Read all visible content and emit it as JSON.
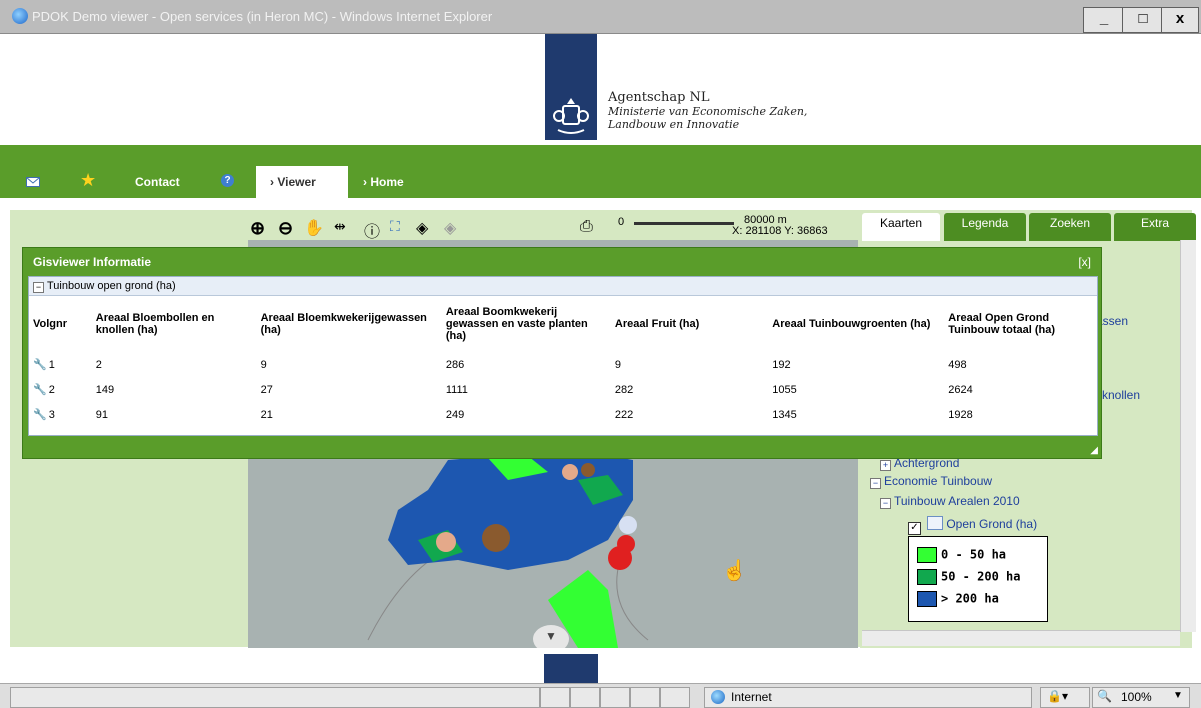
{
  "window": {
    "title": "PDOK Demo viewer - Open services (in Heron MC) - Windows Internet Explorer",
    "min": "_",
    "max": "□",
    "close": "x"
  },
  "header": {
    "agency_name": "Agentschap NL",
    "ministry_line1": "Ministerie van Economische Zaken,",
    "ministry_line2": "Landbouw en Innovatie"
  },
  "nav": {
    "contact": "Contact",
    "viewer": "› Viewer",
    "home": "› Home"
  },
  "toolbar": {
    "scale_start": "0",
    "scale_end": "80000 m",
    "coords": "X: 281108   Y: 36863"
  },
  "tabs": [
    "Kaarten",
    "Legenda",
    "Zoeken",
    "Extra"
  ],
  "popup": {
    "title": "Gisviewer Informatie",
    "close": "[x]",
    "group_label": "Tuinbouw open grond (ha)",
    "columns": [
      "Volgnr",
      "Areaal Bloembollen en knollen (ha)",
      "Areaal Bloemkwekerijgewassen (ha)",
      "Areaal Boomkwekerij gewassen en vaste planten (ha)",
      "Areaal Fruit (ha)",
      "Areaal Tuinbouwgroenten (ha)",
      "Areaal Open Grond Tuinbouw totaal (ha)"
    ],
    "rows": [
      [
        "1",
        "2",
        "9",
        "286",
        "9",
        "192",
        "498"
      ],
      [
        "2",
        "149",
        "27",
        "1111",
        "282",
        "1055",
        "2624"
      ],
      [
        "3",
        "91",
        "21",
        "249",
        "222",
        "1345",
        "1928"
      ]
    ]
  },
  "tree": {
    "partial_1": "vassen",
    "partial_2": "n -knollen",
    "achtergrond": "Achtergrond",
    "economie": "Economie Tuinbouw",
    "arealen": "Tuinbouw Arealen 2010",
    "open_grond": "Open Grond (ha)"
  },
  "legend": [
    {
      "label": "0 - 50 ha",
      "color": "#33ff33"
    },
    {
      "label": "50 - 200 ha",
      "color": "#11a84e"
    },
    {
      "label": "> 200 ha",
      "color": "#1d57b0"
    }
  ],
  "status": {
    "zone": "Internet",
    "zoom": "100%"
  }
}
